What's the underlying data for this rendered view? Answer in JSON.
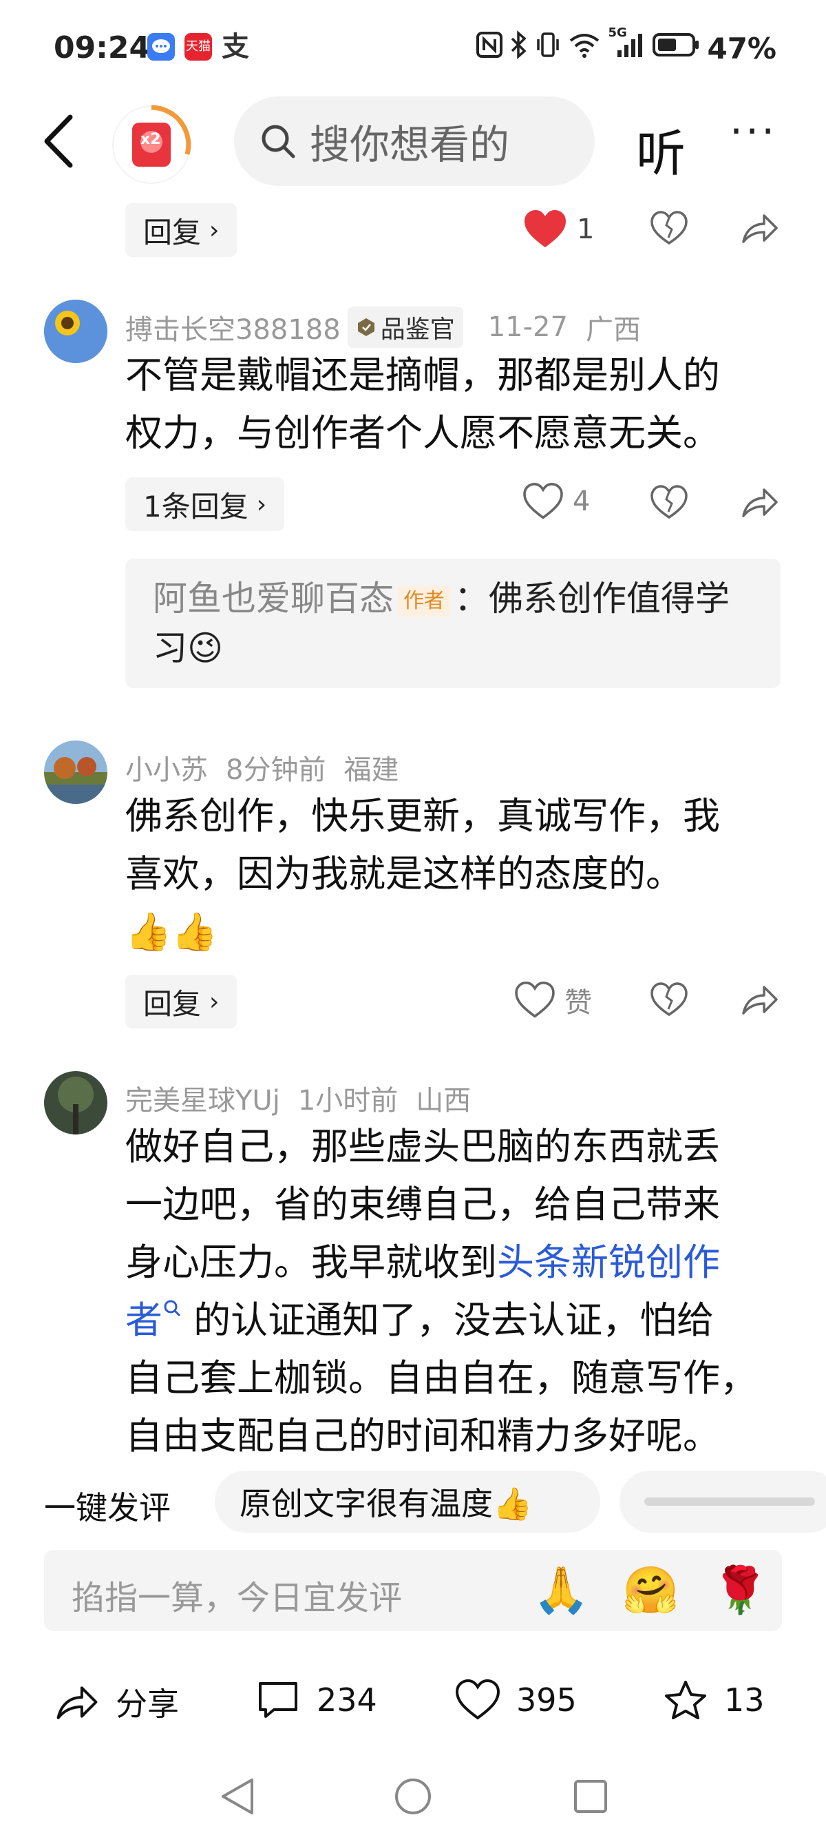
{
  "status_bar": {
    "time": "09:24",
    "battery": "47%",
    "network": "5G",
    "app_icons": [
      "message-icon",
      "tmall-icon",
      "alipay-icon"
    ],
    "tmall_text": "天猫",
    "alipay_text": "支"
  },
  "nav": {
    "redpack_text": "x2",
    "search_placeholder": "搜你想看的",
    "listen_label": "听",
    "more_label": "···"
  },
  "top_actions": {
    "reply_label": "回复",
    "like_count": "1"
  },
  "comments": [
    {
      "user": "搏击长空388188",
      "badge": "品鉴官",
      "date": "11-27",
      "location": "广西",
      "lines": [
        "不管是戴帽还是摘帽，那都是别人的",
        "权力，与创作者个人愿不愿意无关。"
      ],
      "reply_label": "1条回复",
      "like_count": "4",
      "reply": {
        "name": "阿鱼也爱聊百态",
        "tag": "作者",
        "text_1": "：佛系创作值得学",
        "text_2": "习",
        "emoji": "😉"
      }
    },
    {
      "user": "小小苏",
      "date": "8分钟前",
      "location": "福建",
      "lines": [
        "佛系创作，快乐更新，真诚写作，我",
        "喜欢，因为我就是这样的态度的。"
      ],
      "emoji_line": "👍👍",
      "reply_label": "回复",
      "like_label": "赞"
    },
    {
      "user": "完美星球YUj",
      "date": "1小时前",
      "location": "山西",
      "line_1": "做好自己，那些虚头巴脑的东西就丢",
      "line_2": "一边吧，省的束缚自己，给自己带来",
      "line_3_a": "身心压力。我早就收到",
      "link_a": "头条新锐创作",
      "link_b": "者",
      "line_4_b": " 的认证通知了，没去认证，怕给",
      "line_5": "自己套上枷锁。自由自在，随意写作，",
      "line_6": "自由支配自己的时间和精力多好呢。"
    }
  ],
  "quick_comment": {
    "label": "一键发评",
    "chip_1": "原创文字很有温度👍",
    "chip_2": "blurred"
  },
  "input": {
    "placeholder": "掐指一算，今日宜发评",
    "emojis": [
      "🙏",
      "🤗",
      "🌹"
    ]
  },
  "bottom_bar": {
    "share_label": "分享",
    "comment_count": "234",
    "like_count": "395",
    "fav_count": "13"
  },
  "colors": {
    "like_red": "#e8343d",
    "link_blue": "#2a5bd7",
    "author_tag": "#e08b24",
    "pill_bg": "#f4f4f4"
  }
}
